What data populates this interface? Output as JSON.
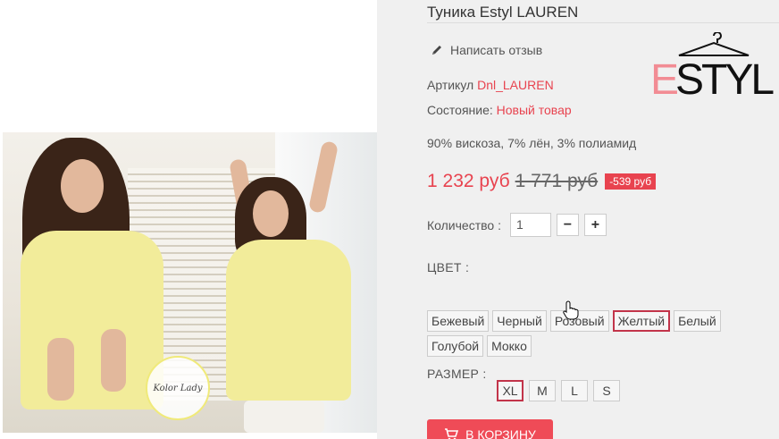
{
  "product": {
    "title": "Туника Estyl LAUREN",
    "review_link": "Написать отзыв",
    "article_label": "Артикул",
    "article_value": "Dnl_LAUREN",
    "state_label": "Состояние:",
    "state_value": "Новый товар",
    "composition": "90% вискоза, 7% лён, 3% полиамид",
    "price": "1 232 руб",
    "old_price": "1 771 руб",
    "discount": "-539 руб"
  },
  "brand": {
    "logo_text_e": "E",
    "logo_text_rest": "STYL",
    "photo_logo_text": "Kolor Lady"
  },
  "quantity": {
    "label": "Количество :",
    "value": "1",
    "minus_label": "−",
    "plus_label": "+"
  },
  "color": {
    "label": "ЦВЕТ :",
    "options": [
      "Бежевый",
      "Черный",
      "Розовый",
      "Желтый",
      "Белый",
      "Голубой",
      "Мокко"
    ],
    "selected": "Желтый"
  },
  "size": {
    "label": "РАЗМЕР :",
    "options": [
      "XL",
      "M",
      "L",
      "S"
    ],
    "selected": "XL"
  },
  "cart": {
    "button_label": "В КОРЗИНУ"
  },
  "colors": {
    "accent": "#e8434f",
    "selected_border": "#c2344a",
    "panel_bg": "#f0f0f0"
  }
}
